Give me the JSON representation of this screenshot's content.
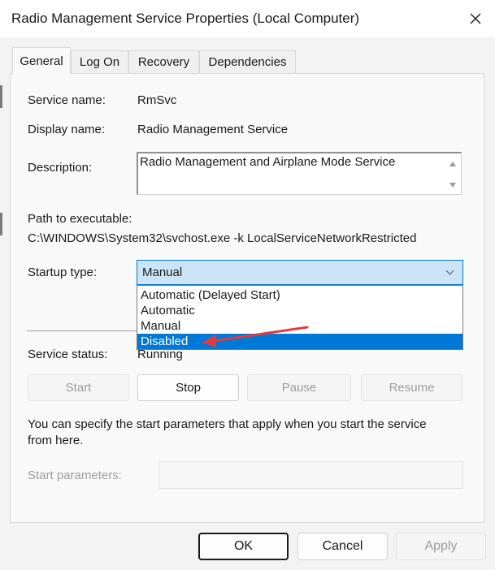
{
  "window": {
    "title": "Radio Management Service Properties (Local Computer)"
  },
  "tabs": [
    {
      "label": "General",
      "active": true
    },
    {
      "label": "Log On",
      "active": false
    },
    {
      "label": "Recovery",
      "active": false
    },
    {
      "label": "Dependencies",
      "active": false
    }
  ],
  "general": {
    "service_name_label": "Service name:",
    "service_name": "RmSvc",
    "display_name_label": "Display name:",
    "display_name": "Radio Management Service",
    "description_label": "Description:",
    "description": "Radio Management and Airplane Mode Service",
    "path_label": "Path to executable:",
    "path": "C:\\WINDOWS\\System32\\svchost.exe -k LocalServiceNetworkRestricted",
    "startup_label": "Startup type:",
    "startup_value": "Manual",
    "startup_options": [
      "Automatic (Delayed Start)",
      "Automatic",
      "Manual",
      "Disabled"
    ],
    "startup_highlighted": "Disabled",
    "status_label": "Service status:",
    "status_value": "Running",
    "buttons": {
      "start": "Start",
      "stop": "Stop",
      "pause": "Pause",
      "resume": "Resume"
    },
    "help_text_line1": "You can specify the start parameters that apply when you start the service",
    "help_text_line2": "from here.",
    "start_params_label": "Start parameters:",
    "start_params_value": ""
  },
  "footer": {
    "ok": "OK",
    "cancel": "Cancel",
    "apply": "Apply"
  },
  "colors": {
    "accent": "#0078d7",
    "select_bg": "#cce4f7",
    "annotation_arrow": "#e03c3c"
  }
}
